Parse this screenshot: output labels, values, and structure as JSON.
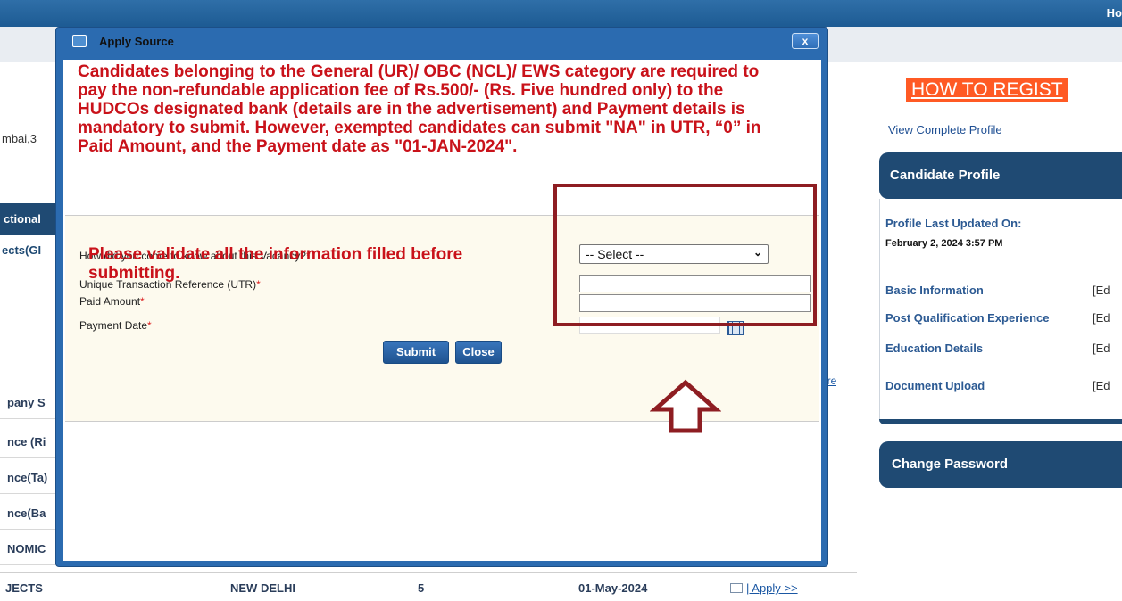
{
  "header": {
    "home_label": "Ho"
  },
  "background_left": {
    "address_snippet": "mbai,3",
    "table_header": "ctional",
    "row_projects": "ects(GI",
    "more_link": "ore",
    "rows": [
      "pany S",
      "nce (Ri",
      "nce(Ta)",
      "nce(Ba",
      "NOMIC"
    ]
  },
  "bottom_row": {
    "dept": "JECTS",
    "location": "NEW DELHI",
    "count": "5",
    "date": "01-May-2024",
    "apply": "| Apply >>"
  },
  "right_panel": {
    "how_to": "HOW TO REGIST",
    "view_profile": "View Complete Profile",
    "candidate_profile": "Candidate Profile",
    "last_updated_label": "Profile Last Updated On:",
    "last_updated_value": "February 2, 2024 3:57 PM",
    "items": [
      {
        "label": "Basic Information",
        "edit": "[Ed"
      },
      {
        "label": "Post Qualification Experience",
        "edit": "[Ed"
      },
      {
        "label": "Education Details",
        "edit": "[Ed"
      },
      {
        "label": "Document Upload",
        "edit": "[Ed"
      }
    ],
    "change_password": "Change Password"
  },
  "dialog": {
    "title": "Apply Source",
    "close_icon": "x",
    "notice": "Candidates belonging to the General (UR)/ OBC (NCL)/ EWS category are required to pay the non-refundable application fee of Rs.500/- (Rs. Five hundred only) to the HUDCOs designated bank (details are in the advertisement) and Payment details is mandatory to submit. However, exempted candidates can submit \"NA\" in UTR, “0” in Paid Amount, and the Payment date as \"01-JAN-2024\".",
    "form": {
      "vacancy_label": "How did you come to know about this Vacancy?",
      "vacancy_value": "-- Select --",
      "utr_label": "Unique Transaction Reference (UTR)",
      "utr_value": "",
      "amount_label": "Paid Amount",
      "amount_value": "",
      "date_label": "Payment Date",
      "date_value": "",
      "required_mark": "*",
      "submit": "Submit",
      "close": "Close"
    },
    "validate_note": "Please validate all the information filled before submitting."
  },
  "annotations": {
    "highlight_color": "#8e1d22",
    "arrow": "up-arrow-icon"
  }
}
